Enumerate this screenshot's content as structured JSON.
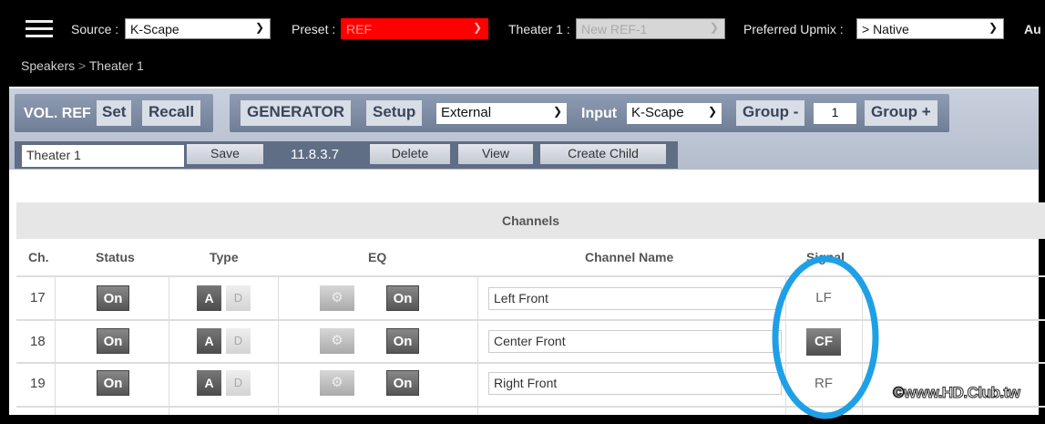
{
  "topbar": {
    "source_label": "Source :",
    "source_value": "K-Scape",
    "preset_label": "Preset :",
    "preset_value": "REF",
    "theater_label": "Theater 1 :",
    "theater_value": "New REF-1",
    "upmix_label": "Preferred Upmix :",
    "upmix_value": "> Native",
    "cut_label": "Au"
  },
  "breadcrumb": {
    "parent": "Speakers",
    "sep": ">",
    "current": "Theater 1"
  },
  "toolbar": {
    "volref": "VOL. REF",
    "set": "Set",
    "recall": "Recall",
    "generator": "GENERATOR",
    "setup": "Setup",
    "generator_mode": "External",
    "input_label": "Input",
    "input_value": "K-Scape",
    "group_minus": "Group -",
    "group_value": "1",
    "group_plus": "Group +"
  },
  "config": {
    "name_value": "Theater 1",
    "save": "Save",
    "version": "11.8.3.7",
    "delete": "Delete",
    "view": "View",
    "create_child": "Create Child"
  },
  "table": {
    "title": "Channels",
    "headers": [
      "Ch.",
      "Status",
      "Type",
      "EQ",
      "Channel Name",
      "Signal"
    ],
    "rows": [
      {
        "ch": "17",
        "status": "On",
        "type_a": "A",
        "type_d": "D",
        "eq": "On",
        "name": "Left Front",
        "signal": "LF"
      },
      {
        "ch": "18",
        "status": "On",
        "type_a": "A",
        "type_d": "D",
        "eq": "On",
        "name": "Center Front",
        "signal": "CF"
      },
      {
        "ch": "19",
        "status": "On",
        "type_a": "A",
        "type_d": "D",
        "eq": "On",
        "name": "Right Front",
        "signal": "RF"
      }
    ]
  },
  "annotation": {
    "color": "#1fa0e6"
  },
  "watermark": "©www.HD.Club.tw"
}
